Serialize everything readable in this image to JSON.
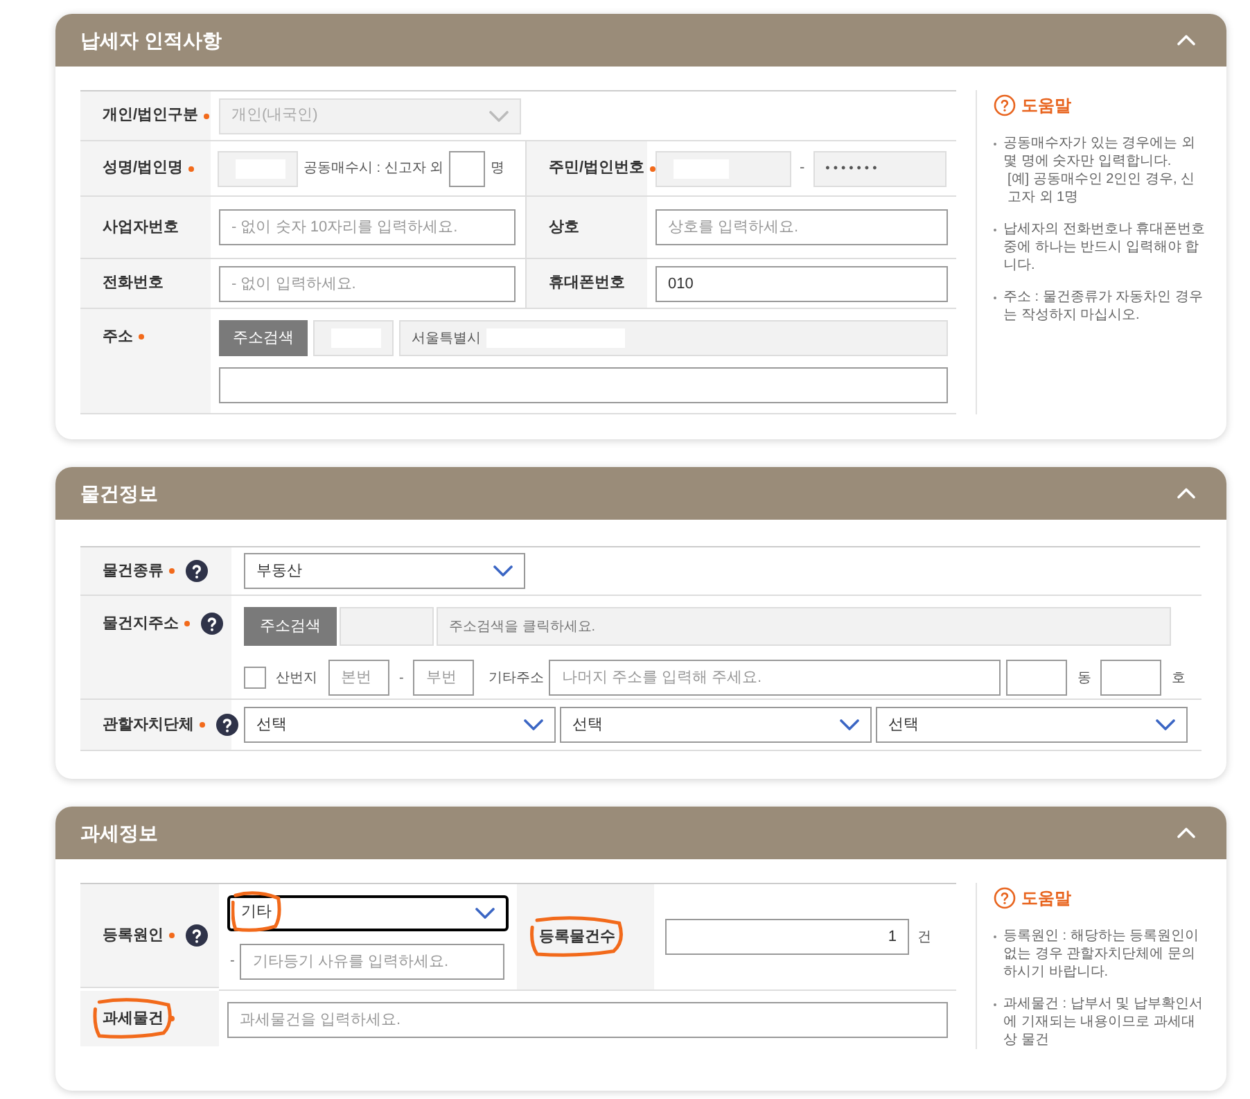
{
  "taxpayer": {
    "title": "납세자 인적사항",
    "expanded": true,
    "type_field": {
      "label": "개인/법인구분",
      "required": true,
      "value": "개인(내국인)",
      "disabled": true
    },
    "name_field": {
      "label": "성명/법인명",
      "required": true,
      "co_buyer_label": "공동매수시 : 신고자 외",
      "co_buyer_unit": "명"
    },
    "id_field": {
      "label": "주민/법인번호",
      "required": true,
      "separator": "-",
      "back_value": "• • • • • • •"
    },
    "business_field": {
      "label": "사업자번호",
      "placeholder": "- 없이 숫자 10자리를 입력하세요."
    },
    "trade_field": {
      "label": "상호",
      "placeholder": "상호를 입력하세요."
    },
    "phone_field": {
      "label": "전화번호",
      "placeholder": "- 없이 입력하세요."
    },
    "mobile_field": {
      "label": "휴대폰번호",
      "value": "010"
    },
    "address_field": {
      "label": "주소",
      "required": true,
      "search_button": "주소검색",
      "city": "서울특별시"
    },
    "help": {
      "title": "도움말",
      "items": [
        {
          "text": "공동매수자가 있는 경우에는 외 몇 명에 숫자만 입력합니다.",
          "example": "[예] 공동매수인 2인인 경우, 신고자 외 1명"
        },
        {
          "text": "납세자의 전화번호나 휴대폰번호 중에 하나는 반드시 입력해야 합니다."
        },
        {
          "text": "주소 : 물건종류가 자동차인 경우는 작성하지 마십시오."
        }
      ]
    }
  },
  "property": {
    "title": "물건정보",
    "expanded": true,
    "kind_field": {
      "label": "물건종류",
      "required": true,
      "value": "부동산"
    },
    "location_field": {
      "label": "물건지주소",
      "required": true,
      "search_button": "주소검색",
      "placeholder": "주소검색을 클릭하세요.",
      "mountain": {
        "label": "산번지",
        "checked": false
      },
      "main_placeholder": "본번",
      "separator": "-",
      "sub_placeholder": "부번",
      "etc_label": "기타주소",
      "etc_placeholder": "나머지 주소를 입력해 주세요.",
      "dong_unit": "동",
      "ho_unit": "호"
    },
    "authority_field": {
      "label": "관할자치단체",
      "required": true,
      "selects": [
        "선택",
        "선택",
        "선택"
      ]
    }
  },
  "taxation": {
    "title": "과세정보",
    "expanded": true,
    "reason_field": {
      "label": "등록원인",
      "required": true,
      "value": "기타",
      "focused": true,
      "circled": true,
      "other_prefix": "-",
      "other_placeholder": "기타등기 사유를 입력하세요."
    },
    "count_field": {
      "label": "등록물건수",
      "circled": true,
      "value": "1",
      "unit": "건"
    },
    "object_field": {
      "label": "과세물건",
      "required": true,
      "circled": true,
      "placeholder": "과세물건을 입력하세요."
    },
    "help": {
      "title": "도움말",
      "items": [
        {
          "text": "등록원인 : 해당하는 등록원인이 없는 경우 관할자치단체에 문의하시기 바랍니다."
        },
        {
          "text": "과세물건 : 납부서 및 납부확인서에 기재되는 내용이므로 과세대상 물건"
        }
      ]
    }
  }
}
